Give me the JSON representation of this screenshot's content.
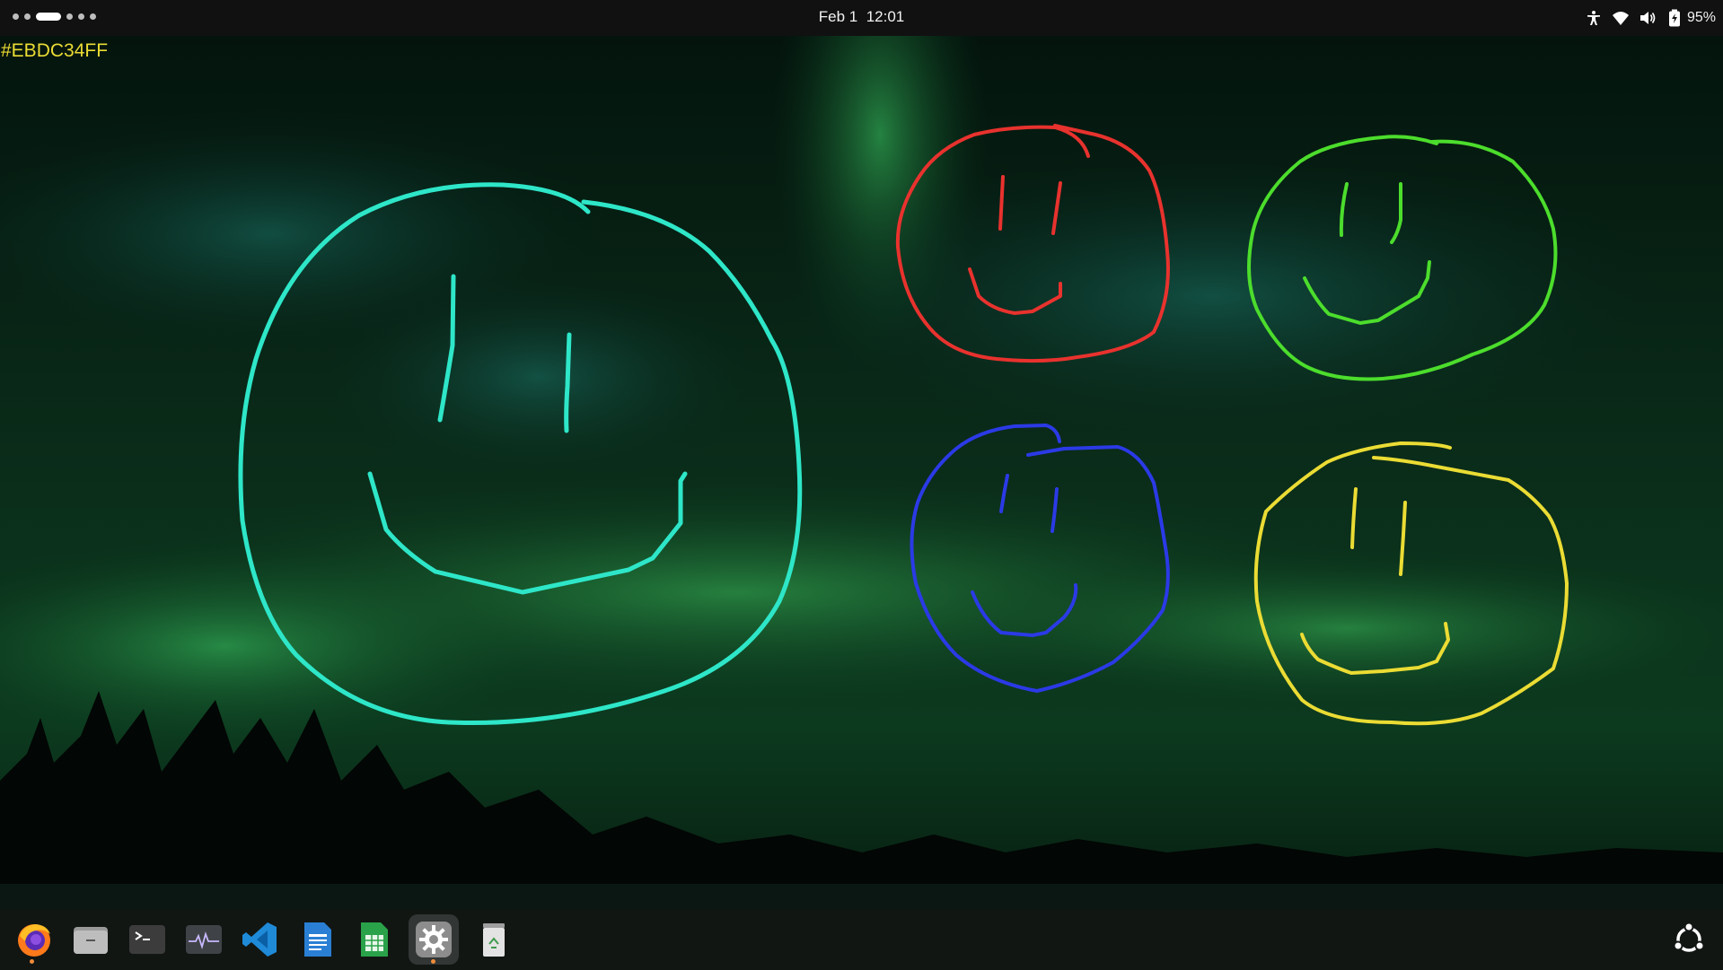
{
  "topbar": {
    "date": "Feb 1",
    "time": "12:01",
    "battery_percent": "95%",
    "workspace_count": 6,
    "active_workspace": 3,
    "tray_icons": [
      "accessibility-icon",
      "wifi-icon",
      "volume-icon",
      "battery-icon"
    ]
  },
  "color_readout": "#EBDC34FF",
  "drawings": [
    {
      "name": "teal-smiley",
      "color": "#2EE6C8"
    },
    {
      "name": "red-smiley",
      "color": "#E8322E"
    },
    {
      "name": "green-smiley",
      "color": "#4CDD2C"
    },
    {
      "name": "blue-smiley",
      "color": "#2B3AE6"
    },
    {
      "name": "yellow-smiley",
      "color": "#EBDC34"
    }
  ],
  "dock": {
    "apps": [
      {
        "name": "firefox",
        "icon": "firefox-icon",
        "running": true
      },
      {
        "name": "files",
        "icon": "folder-icon",
        "running": false
      },
      {
        "name": "terminal",
        "icon": "terminal-icon",
        "running": false
      },
      {
        "name": "system-monitor",
        "icon": "activity-icon",
        "running": false
      },
      {
        "name": "vscode",
        "icon": "vscode-icon",
        "running": false
      },
      {
        "name": "writer",
        "icon": "document-icon",
        "running": false
      },
      {
        "name": "calc",
        "icon": "spreadsheet-icon",
        "running": false
      },
      {
        "name": "settings",
        "icon": "gear-icon",
        "running": true,
        "active": true
      },
      {
        "name": "trash",
        "icon": "trash-icon",
        "running": false
      }
    ],
    "show_apps_icon": "ubuntu-logo-icon"
  },
  "colors": {
    "topbar_bg": "#111111",
    "accent_running": "#F08B3A",
    "aurora_green": "#1E8A3C"
  }
}
